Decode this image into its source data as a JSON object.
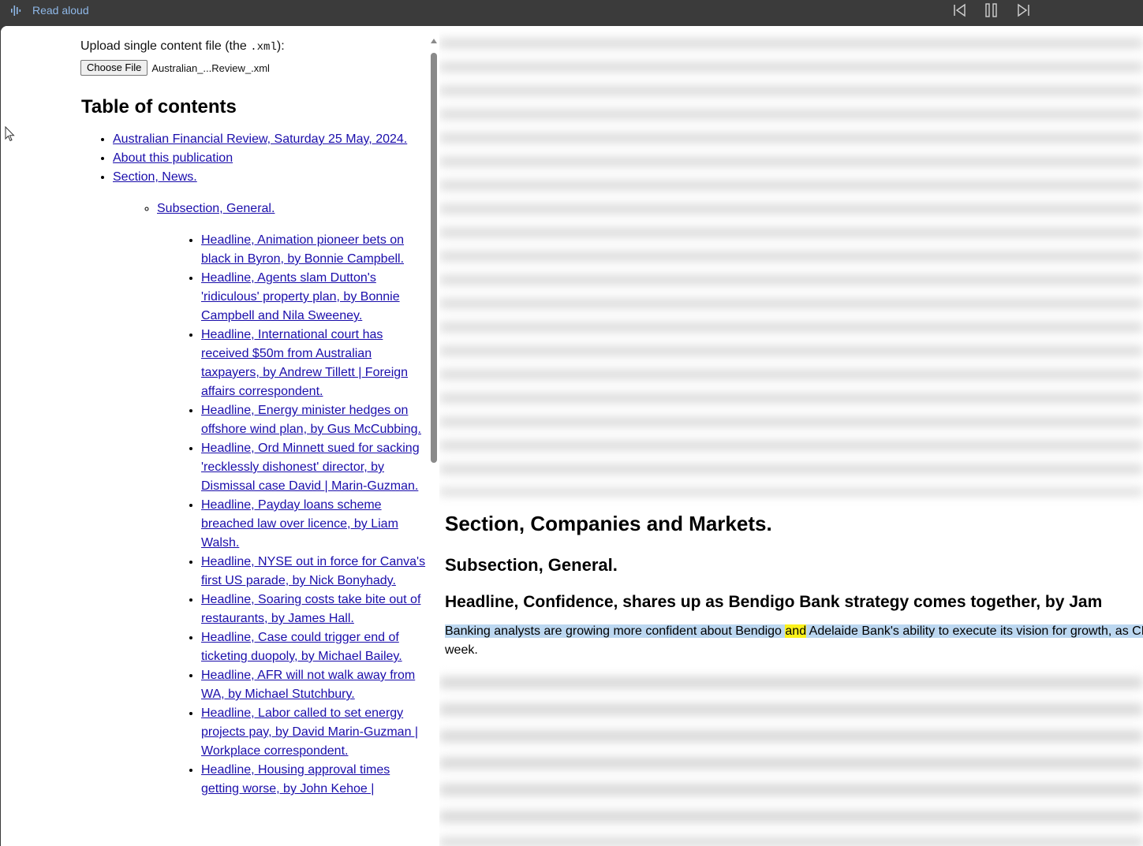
{
  "read_aloud": {
    "label": "Read aloud",
    "controls": [
      "previous-icon",
      "pause-icon",
      "next-icon"
    ]
  },
  "upload": {
    "label_prefix": "Upload single content file (the ",
    "label_code": ".xml",
    "label_suffix": "):",
    "button_label": "Choose File",
    "file_name": "Australian_...Review_.xml"
  },
  "toc": {
    "title": "Table of contents",
    "top_items": [
      "Australian Financial Review, Saturday 25 May, 2024.",
      "About this publication",
      "Section, News."
    ],
    "subsection": "Subsection, General.",
    "headlines": [
      "Headline, Animation pioneer bets on black in Byron, by Bonnie Campbell.",
      "Headline, Agents slam Dutton's 'ridiculous' property plan, by Bonnie Campbell and Nila Sweeney.",
      "Headline, International court has received $50m from Australian taxpayers, by Andrew Tillett | Foreign affairs correspondent.",
      "Headline, Energy minister hedges on offshore wind plan, by Gus McCubbing.",
      "Headline, Ord Minnett sued for sacking 'recklessly dishonest' director, by Dismissal case David | Marin-Guzman.",
      "Headline, Payday loans scheme breached law over licence, by Liam Walsh.",
      "Headline, NYSE out in force for Canva's first US parade, by Nick Bonyhady.",
      "Headline, Soaring costs take bite out of restaurants, by James Hall.",
      "Headline, Case could trigger end of ticketing duopoly, by Michael Bailey.",
      "Headline, AFR will not walk away from WA, by Michael Stutchbury.",
      "Headline, Labor called to set energy projects pay, by David Marin-Guzman | Workplace correspondent.",
      "Headline, Housing approval times getting worse, by John Kehoe |"
    ]
  },
  "article": {
    "section_title": "Section, Companies and Markets.",
    "subsection_title": "Subsection, General.",
    "headline": "Headline, Confidence, shares up as Bendigo Bank strategy comes together, by Jam",
    "para_before": "Banking analysts are growing more confident about Bendigo ",
    "para_word": "and",
    "para_after": " Adelaide Bank's ability to execute its vision for growth, as CE",
    "para_line2": "week."
  }
}
